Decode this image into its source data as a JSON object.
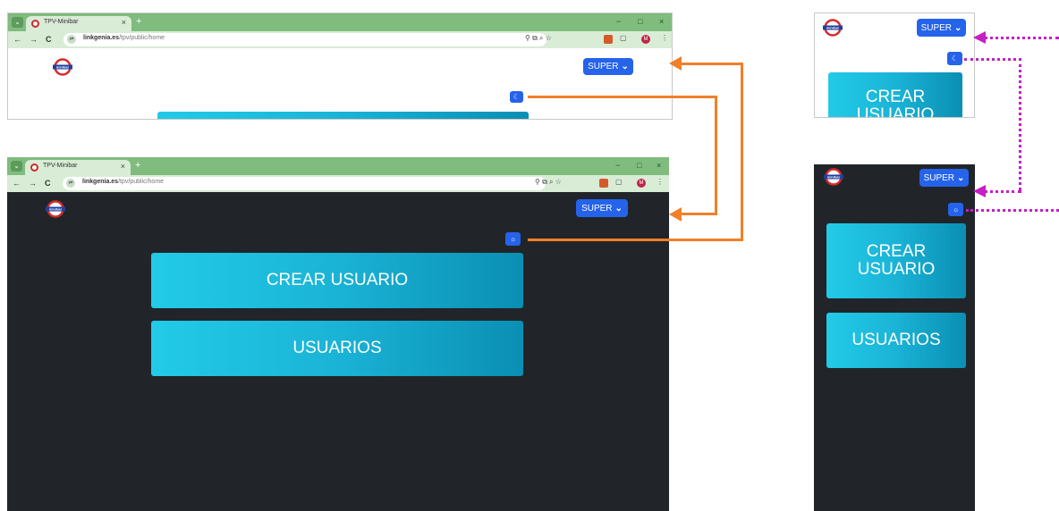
{
  "browser": {
    "tab_title": "TPV-Minibar",
    "tab_close": "×",
    "new_tab": "+",
    "minimize": "−",
    "maximize": "□",
    "close": "×",
    "url_domain": "linkgenia.es",
    "url_path": "/tpv/public/home",
    "back": "←",
    "forward": "→",
    "reload": "C",
    "toolbar_icons": "⚲ ⧉ ⌕ ☆",
    "profile_initial": "M",
    "menu": "⋮"
  },
  "app": {
    "logo_text": "minibar",
    "super_label": "SUPER",
    "dropdown_glyph": "⌄",
    "moon_icon": "☾",
    "sun_icon": "☼",
    "crear_usuario_label": "CREAR USUARIO",
    "crear_mobile_line1": "CREAR",
    "crear_mobile_line2": "USUARIO",
    "usuarios_label": "USUARIOS"
  },
  "colors": {
    "accent": "#2563eb",
    "dark_bg": "#212529",
    "button_gradient_start": "#22cbe8",
    "button_gradient_end": "#0a8fb3",
    "chrome_green": "#7fbc7d",
    "connector_orange": "#f0802a",
    "connector_magenta": "#c61fc6"
  }
}
